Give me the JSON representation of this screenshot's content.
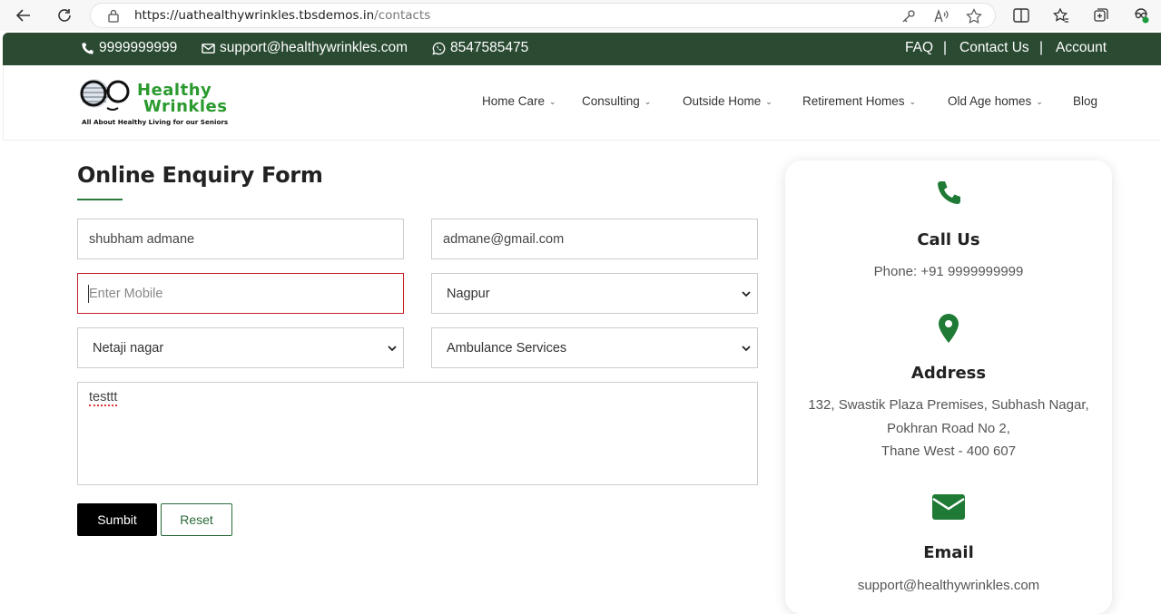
{
  "browser": {
    "url_domain": "https://uathealthywrinkles.tbsdemos.in",
    "url_path": "/contacts"
  },
  "topbar": {
    "phone": "9999999999",
    "email": "support@healthywrinkles.com",
    "whatsapp": "8547585475",
    "links": [
      "FAQ",
      "Contact Us",
      "Account"
    ],
    "separator": "|"
  },
  "logo": {
    "line1": "Healthy",
    "line2": "Wrinkles",
    "tagline": "All About Healthy Living for our Seniors"
  },
  "menu": {
    "items": [
      {
        "label": "Home Care",
        "dropdown": true
      },
      {
        "label": "Consulting",
        "dropdown": true
      },
      {
        "label": "Outside Home",
        "dropdown": true
      },
      {
        "label": "Retirement Homes",
        "dropdown": true
      },
      {
        "label": "Old Age homes",
        "dropdown": true
      },
      {
        "label": "Blog",
        "dropdown": false
      }
    ]
  },
  "form": {
    "title": "Online Enquiry Form",
    "name_value": "shubham admane",
    "email_value": "admane@gmail.com",
    "mobile_placeholder": "Enter Mobile",
    "city_selected": "Nagpur",
    "area_selected": "Netaji nagar",
    "service_selected": "Ambulance Services",
    "message_value": "testtt",
    "submit_label": "Sumbit",
    "reset_label": "Reset"
  },
  "contact_card": {
    "call_heading": "Call Us",
    "call_text": "Phone: +91 9999999999",
    "address_heading": "Address",
    "address_lines": [
      "132, Swastik Plaza Premises, Subhash Nagar,",
      "Pokhran Road No 2,",
      "Thane West - 400 607"
    ],
    "email_heading": "Email",
    "email_text": "support@healthywrinkles.com"
  },
  "colors": {
    "topbar_bg": "#2a4a32",
    "accent_green": "#1e7a34",
    "error_border": "#c4222a"
  }
}
